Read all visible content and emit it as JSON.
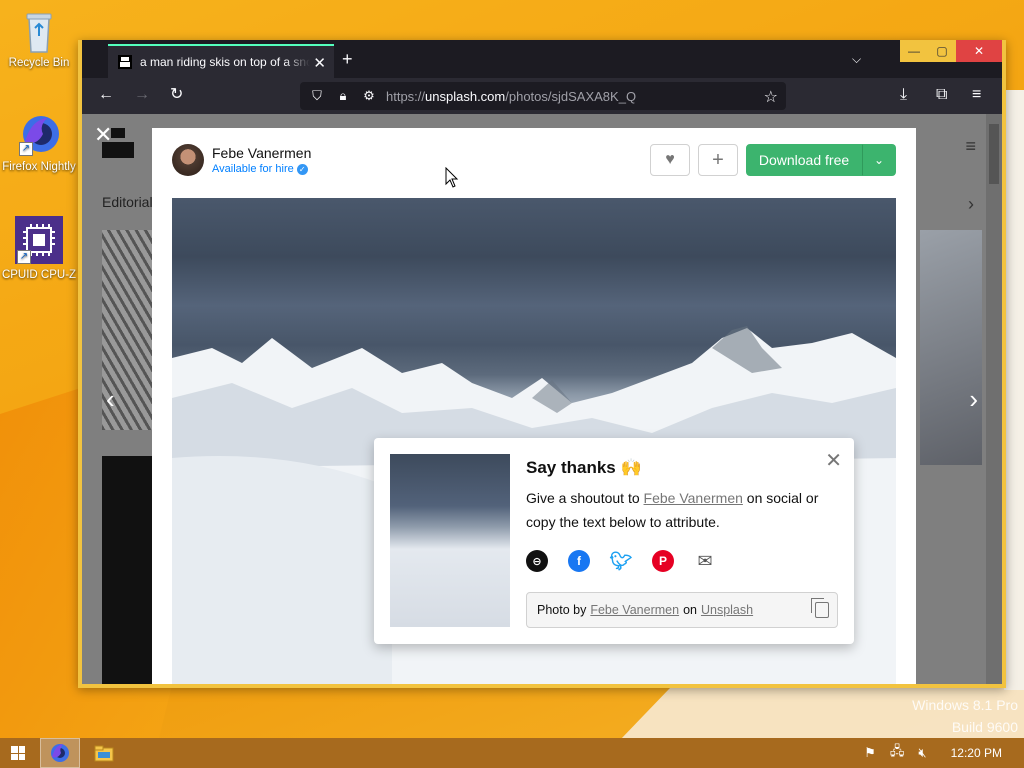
{
  "desktop": {
    "icons": [
      {
        "label": "Recycle Bin"
      },
      {
        "label": "Firefox Nightly"
      },
      {
        "label": "CPUID CPU-Z"
      }
    ],
    "watermark_line1": "Windows 8.1 Pro",
    "watermark_line2": "Build 9600"
  },
  "browser": {
    "tab_title": "a man riding skis on top of a snow covered mountain",
    "tab_close": "✕",
    "new_tab": "+",
    "list_all_tabs": "⌵",
    "window_controls": {
      "minimize": "—",
      "maximize": "▢",
      "close": "✕"
    },
    "nav": {
      "back": "←",
      "forward": "→",
      "reload": "↻"
    },
    "url": {
      "scheme": "https://",
      "host": "unsplash.com",
      "path": "/photos/sjdSAXA8K_Q"
    },
    "bookmark_star": "☆",
    "toolbar": {
      "downloads": "⤓",
      "extensions": "⧉",
      "menu": "≡"
    }
  },
  "page": {
    "background_tab_label": "Editorial",
    "modal_close": "✕",
    "prev_arrow": "‹",
    "next_arrow": "›",
    "author": {
      "name": "Febe Vanermen",
      "status": "Available for hire"
    },
    "actions": {
      "like": "♥",
      "add": "+",
      "download": "Download free",
      "download_caret": "⌄"
    },
    "say_thanks": {
      "title": "Say thanks 🙌",
      "text_before": "Give a shoutout to ",
      "author_link": "Febe Vanermen",
      "text_after": " on social or copy the text below to attribute.",
      "close": "✕",
      "attribution": {
        "prefix": "Photo by",
        "author": "Febe Vanermen",
        "on": "on",
        "site": "Unsplash"
      },
      "socials": [
        "link-icon",
        "facebook-icon",
        "twitter-icon",
        "pinterest-icon",
        "email-icon"
      ]
    }
  },
  "taskbar": {
    "clock": "12:20 PM"
  },
  "colors": {
    "accent_green": "#3cb46e",
    "tab_indicator": "#54ffbd",
    "desktop_orange": "#f4a512",
    "taskbar": "#a76a1e"
  }
}
